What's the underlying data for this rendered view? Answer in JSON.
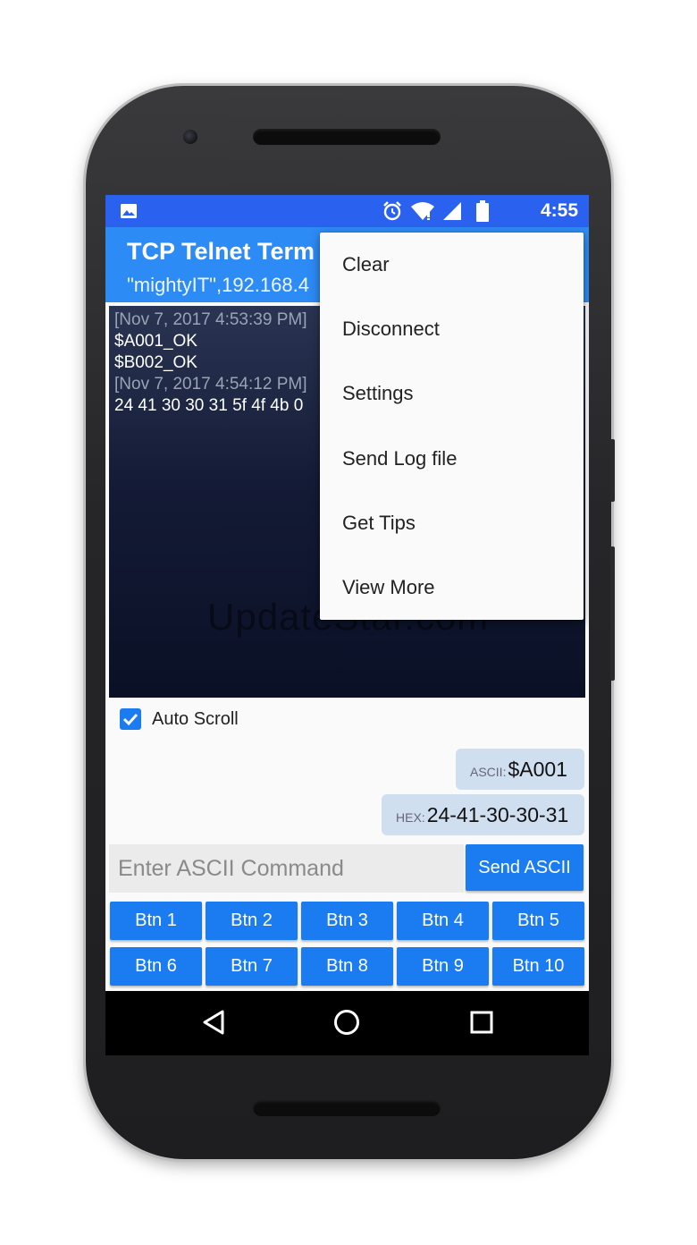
{
  "status_bar": {
    "time": "4:55",
    "icons": [
      "image-icon",
      "alarm-icon",
      "wifi-icon",
      "signal-icon",
      "battery-icon"
    ]
  },
  "app_bar": {
    "title": "TCP Telnet Term",
    "subtitle": "\"mightyIT\",192.168.4"
  },
  "terminal": {
    "lines": [
      {
        "kind": "time",
        "text": "[Nov 7, 2017 4:53:39 PM]"
      },
      {
        "kind": "data",
        "text": "$A001_OK"
      },
      {
        "kind": "data",
        "text": "$B002_OK"
      },
      {
        "kind": "time",
        "text": "[Nov 7, 2017 4:54:12 PM]"
      },
      {
        "kind": "data",
        "text": "24 41 30 30 31 5f 4f 4b 0"
      }
    ],
    "watermark": "UpdateStar.com"
  },
  "auto_scroll": {
    "label": "Auto Scroll",
    "checked": true
  },
  "sent": [
    {
      "tag": "ASCII:",
      "value": "$A001"
    },
    {
      "tag": "HEX:",
      "value": "24-41-30-30-31"
    }
  ],
  "command": {
    "placeholder": "Enter ASCII Command",
    "value": "",
    "send_label": "Send ASCII"
  },
  "buttons": [
    "Btn 1",
    "Btn 2",
    "Btn 3",
    "Btn 4",
    "Btn 5",
    "Btn 6",
    "Btn 7",
    "Btn 8",
    "Btn 9",
    "Btn 10"
  ],
  "menu": {
    "items": [
      "Clear",
      "Disconnect",
      "Settings",
      "Send Log file",
      "Get Tips",
      "View More"
    ]
  },
  "nav_bar": {
    "icons": [
      "back-icon",
      "home-icon",
      "recents-icon"
    ]
  },
  "colors": {
    "status_bar": "#2a62ef",
    "app_bar": "#2d8bf5",
    "accent": "#1a7cf0",
    "bubble": "#cfdff0"
  }
}
